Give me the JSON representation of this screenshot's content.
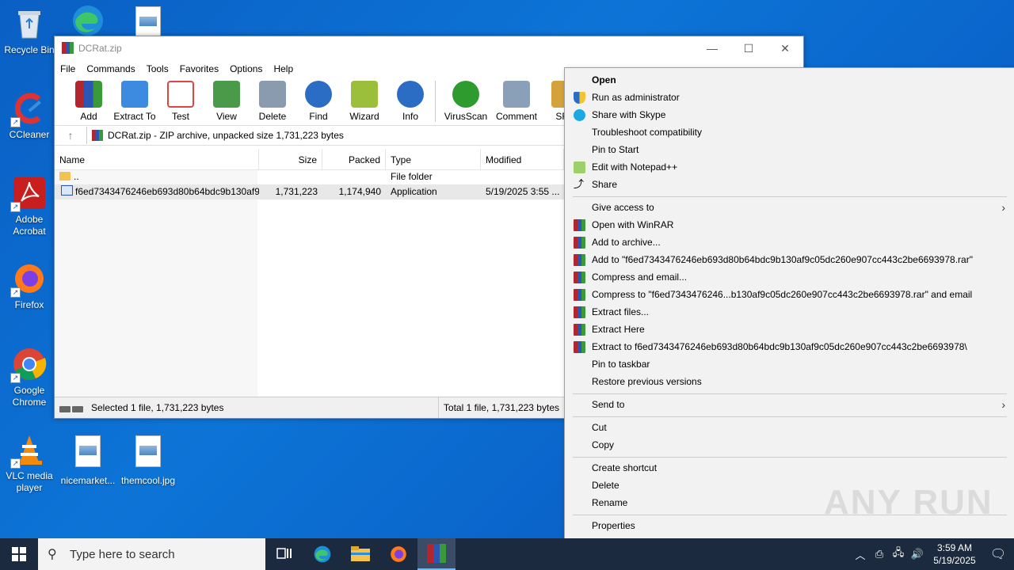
{
  "desktop": {
    "icons": [
      {
        "label": "Recycle Bin"
      },
      {
        "label": "CCleaner"
      },
      {
        "label": "Adobe Acrobat"
      },
      {
        "label": "Firefox"
      },
      {
        "label": "Google Chrome"
      },
      {
        "label": "VLC media player"
      },
      {
        "label": "nicemarket..."
      },
      {
        "label": "themcool.jpg"
      }
    ]
  },
  "window": {
    "title": "DCRat.zip",
    "minimize": "—",
    "maximize": "☐",
    "close": "✕",
    "menu": [
      "File",
      "Commands",
      "Tools",
      "Favorites",
      "Options",
      "Help"
    ],
    "toolbar": [
      {
        "label": "Add",
        "icon": "add-icon",
        "color": "#c0392b"
      },
      {
        "label": "Extract To",
        "icon": "extract-icon",
        "color": "#3d8be0"
      },
      {
        "label": "Test",
        "icon": "test-icon",
        "color": "#d44"
      },
      {
        "label": "View",
        "icon": "view-icon",
        "color": "#4a9a4a"
      },
      {
        "label": "Delete",
        "icon": "delete-icon",
        "color": "#8a9bb0"
      },
      {
        "label": "Find",
        "icon": "find-icon",
        "color": "#2b6cc4"
      },
      {
        "label": "Wizard",
        "icon": "wizard-icon",
        "color": "#9bbf3a"
      },
      {
        "label": "Info",
        "icon": "info-icon",
        "color": "#2b6cc4"
      },
      {
        "label": "VirusScan",
        "icon": "virusscan-icon",
        "color": "#2e9b2e"
      },
      {
        "label": "Comment",
        "icon": "comment-icon",
        "color": "#8aa0b8"
      },
      {
        "label": "SFX",
        "icon": "sfx-icon",
        "color": "#d4a23a"
      }
    ],
    "address": "DCRat.zip - ZIP archive, unpacked size 1,731,223 bytes",
    "columns": {
      "name": "Name",
      "size": "Size",
      "packed": "Packed",
      "type": "Type",
      "modified": "Modified"
    },
    "rows": [
      {
        "name": "..",
        "size": "",
        "packed": "",
        "type": "File folder",
        "modified": ""
      },
      {
        "name": "f6ed7343476246eb693d80b64bdc9b130af9...",
        "size": "1,731,223",
        "packed": "1,174,940",
        "type": "Application",
        "modified": "5/19/2025 3:55 ..."
      }
    ],
    "status_left": "Selected 1 file, 1,731,223 bytes",
    "status_right": "Total 1 file, 1,731,223 bytes"
  },
  "context_menu": {
    "items": [
      {
        "label": "Open",
        "bold": true
      },
      {
        "label": "Run as administrator"
      },
      {
        "label": "Share with Skype"
      },
      {
        "label": "Troubleshoot compatibility"
      },
      {
        "label": "Pin to Start"
      },
      {
        "label": "Edit with Notepad++"
      },
      {
        "label": "Share"
      },
      {
        "label": "Give access to"
      },
      {
        "label": "Open with WinRAR"
      },
      {
        "label": "Add to archive..."
      },
      {
        "label": "Add to \"f6ed7343476246eb693d80b64bdc9b130af9c05dc260e907cc443c2be6693978.rar\""
      },
      {
        "label": "Compress and email..."
      },
      {
        "label": "Compress to \"f6ed7343476246...b130af9c05dc260e907cc443c2be6693978.rar\" and email"
      },
      {
        "label": "Extract files..."
      },
      {
        "label": "Extract Here"
      },
      {
        "label": "Extract to f6ed7343476246eb693d80b64bdc9b130af9c05dc260e907cc443c2be6693978\\"
      },
      {
        "label": "Pin to taskbar"
      },
      {
        "label": "Restore previous versions"
      },
      {
        "label": "Send to"
      },
      {
        "label": "Cut"
      },
      {
        "label": "Copy"
      },
      {
        "label": "Create shortcut"
      },
      {
        "label": "Delete"
      },
      {
        "label": "Rename"
      },
      {
        "label": "Properties"
      }
    ]
  },
  "taskbar": {
    "search_placeholder": "Type here to search",
    "time": "3:59 AM",
    "date": "5/19/2025"
  },
  "watermark": "ANY RUN"
}
